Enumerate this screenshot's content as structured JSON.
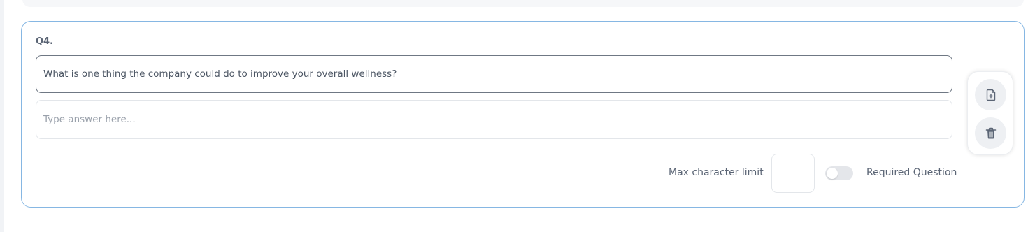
{
  "question": {
    "number_label": "Q4.",
    "text": "What is one thing the company could do to improve your overall wellness?",
    "answer_placeholder": "Type answer here..."
  },
  "settings": {
    "max_char_label": "Max character limit",
    "max_char_value": "",
    "required_label": "Required Question",
    "required_enabled": false
  },
  "actions": {
    "add_icon": "file-plus-icon",
    "delete_icon": "trash-icon"
  },
  "colors": {
    "card_border": "#86b7e3",
    "text": "#5b6575",
    "icon": "#5b6575"
  }
}
